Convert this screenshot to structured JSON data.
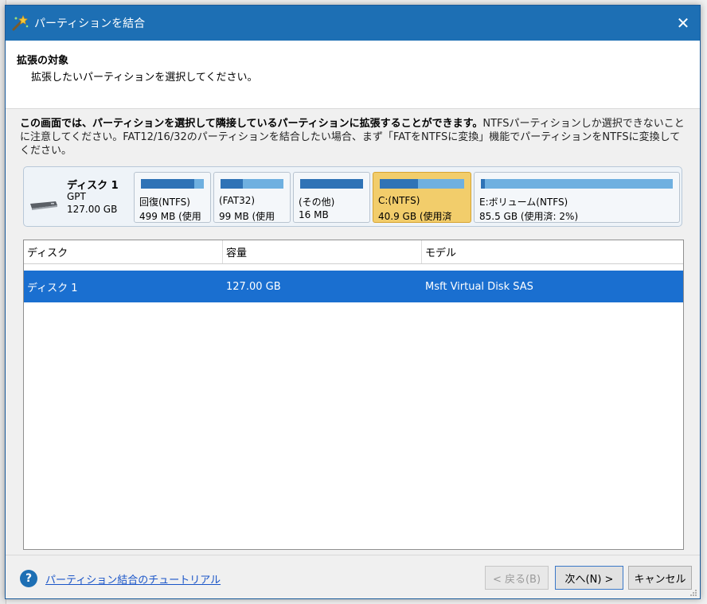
{
  "dialog": {
    "title": "パーティションを結合",
    "close_glyph": "✕"
  },
  "header": {
    "title": "拡張の対象",
    "subtitle": "拡張したいパーティションを選択してください。"
  },
  "description": {
    "bold": "この画面では、パーティションを選択して隣接しているパーティションに拡張することができます。",
    "normal": "NTFSパーティションしか選択できないことに注意してください。FAT12/16/32のパーティションを結合したい場合、まず「FATをNTFSに変換」機能でパーティションをNTFSに変換してください。"
  },
  "disk_map": {
    "disk_name": "ディスク 1",
    "disk_type": "GPT",
    "disk_size": "127.00 GB",
    "partitions": [
      {
        "name": "回復(NTFS)",
        "info": "499 MB (使用",
        "used_fraction": 0.85,
        "selected": false
      },
      {
        "name": "(FAT32)",
        "info": "99 MB (使用",
        "used_fraction": 0.35,
        "selected": false
      },
      {
        "name": "(その他)",
        "info": "16 MB",
        "used_fraction": 1.0,
        "selected": false
      },
      {
        "name": "C:(NTFS)",
        "info": "40.9 GB (使用済",
        "used_fraction": 0.45,
        "selected": true
      },
      {
        "name": "E:ボリューム(NTFS)",
        "info": "85.5 GB (使用済: 2%)",
        "used_fraction": 0.02,
        "selected": false
      }
    ]
  },
  "table": {
    "columns": [
      "ディスク",
      "容量",
      "モデル"
    ],
    "rows": [
      {
        "disk": "ディスク 1",
        "capacity": "127.00 GB",
        "model": "Msft Virtual Disk SAS"
      }
    ]
  },
  "footer": {
    "help_icon": "?",
    "help_link": "パーティション結合のチュートリアル",
    "back_label": "< 戻る(B)",
    "next_label": "次へ(N) >",
    "cancel_label": "キャンセル"
  },
  "colors": {
    "titlebar": "#1d6fb4",
    "selection": "#1a6fd0",
    "selected_partition": "#f2cd6b",
    "bar_used": "#2f73b6",
    "bar_free": "#6fb0e0"
  }
}
